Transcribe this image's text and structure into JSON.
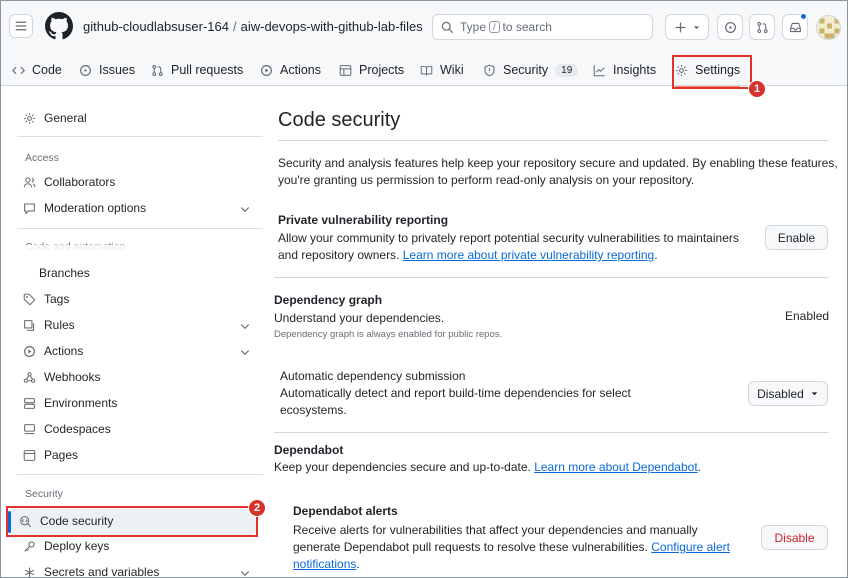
{
  "header": {
    "owner": "github-cloudlabsuser-164",
    "separator": "/",
    "repo": "aiw-devops-with-github-lab-files",
    "search_prefix": "Type",
    "search_key": "/",
    "search_suffix": "to search"
  },
  "tabs": [
    {
      "label": "Code",
      "icon": "code-icon"
    },
    {
      "label": "Issues",
      "icon": "issue-icon"
    },
    {
      "label": "Pull requests",
      "icon": "pull-request-icon"
    },
    {
      "label": "Actions",
      "icon": "play-icon"
    },
    {
      "label": "Projects",
      "icon": "table-icon"
    },
    {
      "label": "Wiki",
      "icon": "book-icon"
    },
    {
      "label": "Security",
      "icon": "shield-icon",
      "count": "19"
    },
    {
      "label": "Insights",
      "icon": "graph-icon"
    },
    {
      "label": "Settings",
      "icon": "gear-icon"
    }
  ],
  "sidebar": {
    "general": "General",
    "access_group": "Access",
    "collaborators": "Collaborators",
    "moderation": "Moderation options",
    "code_group": "Code and automation",
    "branches": "Branches",
    "tags": "Tags",
    "rules": "Rules",
    "actions": "Actions",
    "webhooks": "Webhooks",
    "environments": "Environments",
    "codespaces": "Codespaces",
    "pages": "Pages",
    "security_group": "Security",
    "code_security": "Code security",
    "deploy_keys": "Deploy keys",
    "secrets": "Secrets and variables"
  },
  "callouts": {
    "one": "1",
    "two": "2"
  },
  "main": {
    "title": "Code security",
    "intro_line1": "Security and analysis features help keep your repository secure and updated. By enabling these features,",
    "intro_line2": "you're granting us permission to perform read-only analysis on your repository.",
    "pvr_title": "Private vulnerability reporting",
    "pvr_line1": "Allow your community to privately report potential security vulnerabilities to maintainers",
    "pvr_line2_prefix": "and repository owners.",
    "pvr_link": "Learn more about private vulnerability reporting",
    "pvr_line2_suffix": ".",
    "pvr_button": "Enable",
    "dg_title": "Dependency graph",
    "dg_desc": "Understand your dependencies.",
    "dg_note": "Dependency graph is always enabled for public repos.",
    "dg_status": "Enabled",
    "ads_title": "Automatic dependency submission",
    "ads_line1": "Automatically detect and report build-time dependencies for select",
    "ads_line2": "ecosystems.",
    "ads_button": "Disabled",
    "dependabot_title": "Dependabot",
    "dependabot_desc_prefix": "Keep your dependencies secure and up-to-date.",
    "dependabot_link": "Learn more about Dependabot",
    "dependabot_desc_suffix": ".",
    "alerts_title": "Dependabot alerts",
    "alerts_line1": "Receive alerts for vulnerabilities that affect your dependencies and manually",
    "alerts_line2_prefix": "generate Dependabot pull requests to resolve these vulnerabilities.",
    "alerts_link1": "Configure alert",
    "alerts_link2": "notifications",
    "alerts_line3_suffix": ".",
    "alerts_button": "Disable"
  }
}
